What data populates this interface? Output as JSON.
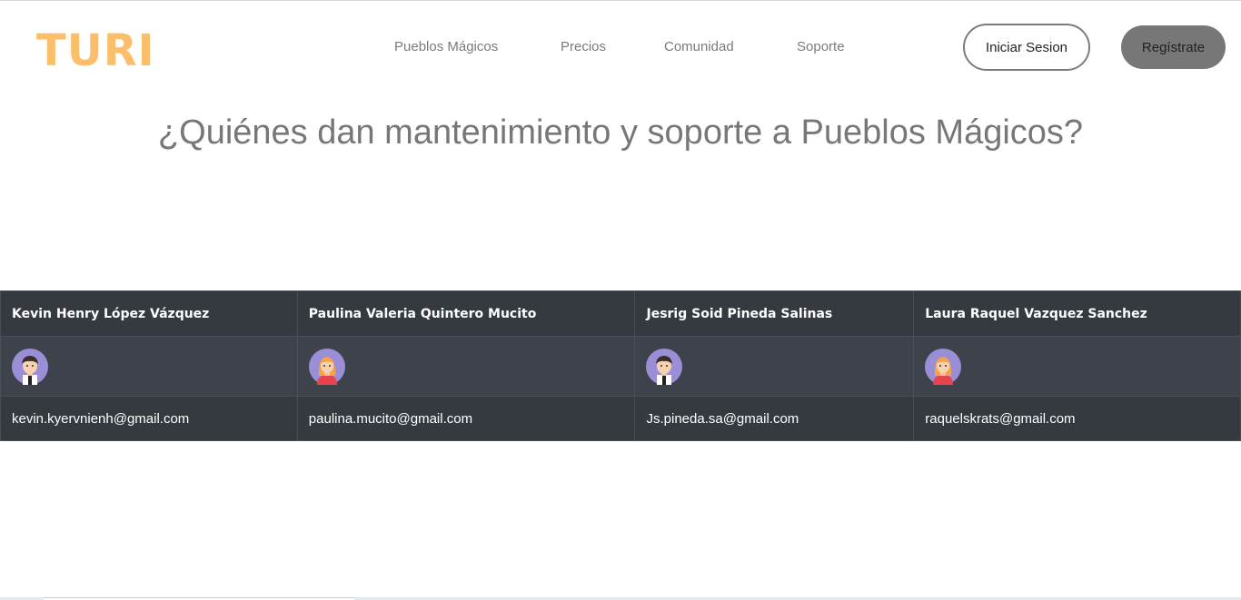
{
  "brand": {
    "logo_text": "TURI",
    "logo_color": "#fbbf6b"
  },
  "nav": {
    "links": [
      {
        "label": "Pueblos Mágicos"
      },
      {
        "label": "Precios"
      },
      {
        "label": "Comunidad"
      },
      {
        "label": "Soporte"
      }
    ],
    "login_label": "Iniciar Sesion",
    "register_label": "Regístrate"
  },
  "main": {
    "title": "¿Quiénes dan mantenimiento y soporte a Pueblos Mágicos?"
  },
  "team": {
    "members": [
      {
        "name": "Kevin Henry López Vázquez",
        "avatar": "male-avatar-icon",
        "email": "kevin.kyervnienh@gmail.com"
      },
      {
        "name": "Paulina Valeria Quintero Mucito",
        "avatar": "female-avatar-icon",
        "email": "paulina.mucito@gmail.com"
      },
      {
        "name": "Jesrig Soid Pineda Salinas",
        "avatar": "male-avatar-icon",
        "email": "Js.pineda.sa@gmail.com"
      },
      {
        "name": "Laura Raquel Vazquez Sanchez",
        "avatar": "female-avatar-icon",
        "email": "raquelskrats@gmail.com"
      }
    ]
  },
  "colors": {
    "table_bg": "#343a40",
    "table_row_alt": "#3e434b",
    "register_button": "#777777",
    "title_text": "#777777"
  }
}
